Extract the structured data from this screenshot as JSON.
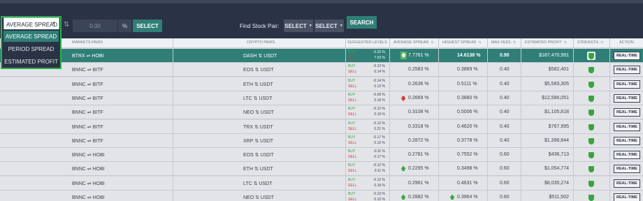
{
  "toolbar": {
    "sort_select": "AVERAGE SPREAD",
    "dropdown_options": [
      "AVERAGE SPREAD",
      "PERIOD SPREAD",
      "ESTIMATED PROFIT"
    ],
    "spread_input_value": "0.00",
    "percent_label": "%",
    "select_button": "SELECT",
    "find_label": "Find Stock Pair:",
    "pair_select_1": "SELECT",
    "pair_select_2": "SELECT",
    "search_button": "SEARCH"
  },
  "headers": {
    "markets_pairs": "MARKETS PAIRS",
    "crypto_pairs": "CRYPTO PAIRS",
    "suggested_levels": "SUGGESTED LEVELS",
    "average_spread": "AVERAGE SPREAD",
    "highest_spread": "HIGHEST SPREAD",
    "max_fees": "MAX FEES",
    "estimated_profit": "ESTIMATED PROFIT",
    "strength": "STRENGTH",
    "action": "ACTION"
  },
  "labels": {
    "buy": "BUY",
    "sell": "SELL",
    "action_button": "REAL-TIME"
  },
  "rows": [
    {
      "market": "BTRX ⇌ HOBI",
      "crypto": "DASH ⇅ USDT",
      "buy": "-0.25 %",
      "sell": "7.53 %",
      "avg": "7.7761 %",
      "avg_trend": "up",
      "high": "14.6138 %",
      "high_trend": "",
      "fees": "0.90",
      "profit": "$187,470,991",
      "highlight": true
    },
    {
      "market": "BNNC ⇌ BITF",
      "crypto": "EOS ⇅ USDT",
      "buy": "-0.12 %",
      "sell": "0.14 %",
      "avg": "0.2583 %",
      "avg_trend": "",
      "high": "0.3869 %",
      "high_trend": "",
      "fees": "0.40",
      "profit": "$582,401",
      "highlight": false
    },
    {
      "market": "BNNC ⇌ BITF",
      "crypto": "ETH ⇅ USDT",
      "buy": "-0.14 %",
      "sell": "0.12 %",
      "avg": "0.2636 %",
      "avg_trend": "",
      "high": "0.5111 %",
      "high_trend": "",
      "fees": "0.40",
      "profit": "$5,583,305",
      "highlight": false
    },
    {
      "market": "BNNC ⇌ BITF",
      "crypto": "LTC ⇅ USDT",
      "buy": "-0.09 %",
      "sell": "0.18 %",
      "avg": "0.2669 %",
      "avg_trend": "down",
      "high": "0.3880 %",
      "high_trend": "",
      "fees": "0.40",
      "profit": "$12,586,051",
      "highlight": false
    },
    {
      "market": "BNNC ⇌ BITF",
      "crypto": "NEO ⇅ USDT",
      "buy": "-0.12 %",
      "sell": "0.19 %",
      "avg": "0.3108 %",
      "avg_trend": "",
      "high": "0.5006 %",
      "high_trend": "",
      "fees": "0.40",
      "profit": "$1,105,818",
      "highlight": false
    },
    {
      "market": "BNNC ⇌ BITF",
      "crypto": "TRX ⇅ USDT",
      "buy": "-0.12 %",
      "sell": "0.21 %",
      "avg": "0.3318 %",
      "avg_trend": "",
      "high": "0.4620 %",
      "high_trend": "",
      "fees": "0.40",
      "profit": "$767,995",
      "highlight": false
    },
    {
      "market": "BNNC ⇌ BITF",
      "crypto": "XRP ⇅ USDT",
      "buy": "-0.17 %",
      "sell": "0.12 %",
      "avg": "0.2872 %",
      "avg_trend": "",
      "high": "0.3778 %",
      "high_trend": "",
      "fees": "0.40",
      "profit": "$1,396,844",
      "highlight": false
    },
    {
      "market": "BNNC ⇌ HOBI",
      "crypto": "EOS ⇅ USDT",
      "buy": "-0.11 %",
      "sell": "0.17 %",
      "avg": "0.2781 %",
      "avg_trend": "",
      "high": "0.7552 %",
      "high_trend": "",
      "fees": "0.60",
      "profit": "$436,713",
      "highlight": false
    },
    {
      "market": "BNNC ⇌ HOBI",
      "crypto": "ETH ⇅ USDT",
      "buy": "-0.12 %",
      "sell": "0.11 %",
      "avg": "0.2295 %",
      "avg_trend": "up",
      "high": "0.3498 %",
      "high_trend": "",
      "fees": "0.60",
      "profit": "$1,054,774",
      "highlight": false
    },
    {
      "market": "BNNC ⇌ HOBI",
      "crypto": "LTC ⇅ USDT",
      "buy": "-0.12 %",
      "sell": "0.18 %",
      "avg": "0.2961 %",
      "avg_trend": "",
      "high": "0.4631 %",
      "high_trend": "",
      "fees": "0.60",
      "profit": "$8,035,274",
      "highlight": false
    },
    {
      "market": "BNNC ⇌ HOBI",
      "crypto": "NEO ⇅ USDT",
      "buy": "-0.13 %",
      "sell": "0.15 %",
      "avg": "0.2882 %",
      "avg_trend": "up",
      "high": "0.3964 %",
      "high_trend": "up",
      "fees": "0.60",
      "profit": "$511,502",
      "highlight": false
    }
  ]
}
